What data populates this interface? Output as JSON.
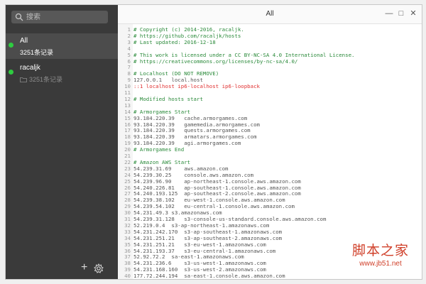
{
  "sidebar": {
    "search_placeholder": "搜索",
    "hosts": [
      {
        "title": "All",
        "subtitle": "3251条记录",
        "active": true
      },
      {
        "title": "racaljk",
        "subtitle": "3251条记录",
        "active": false
      }
    ],
    "add_label": "+",
    "settings_icon": "gear-icon"
  },
  "window": {
    "title": "All",
    "minimize": "—",
    "maximize": "□",
    "close": "✕"
  },
  "editor": {
    "lines": [
      {
        "n": "1",
        "t": "# Copyright (c) 2014-2016, racaljk.",
        "k": "comment"
      },
      {
        "n": "2",
        "t": "# https://github.com/racaljk/hosts",
        "k": "comment"
      },
      {
        "n": "3",
        "t": "# Last updated: 2016-12-18",
        "k": "comment"
      },
      {
        "n": "4",
        "t": "",
        "k": "plain"
      },
      {
        "n": "5",
        "t": "# This work is licensed under a CC BY-NC-SA 4.0 International License.",
        "k": "comment"
      },
      {
        "n": "6",
        "t": "# https://creativecommons.org/licenses/by-nc-sa/4.0/",
        "k": "comment"
      },
      {
        "n": "7",
        "t": "",
        "k": "plain"
      },
      {
        "n": "8",
        "t": "# Localhost (DO NOT REMOVE)",
        "k": "comment"
      },
      {
        "n": "9",
        "t": "127.0.0.1   local.host",
        "k": "plain"
      },
      {
        "n": "10",
        "t": "::1 localhost ip6-localhost ip6-loopback",
        "k": "red"
      },
      {
        "n": "11",
        "t": "",
        "k": "plain"
      },
      {
        "n": "12",
        "t": "# Modified hosts start",
        "k": "comment"
      },
      {
        "n": "13",
        "t": "",
        "k": "plain"
      },
      {
        "n": "14",
        "t": "# Armorgames Start",
        "k": "comment"
      },
      {
        "n": "15",
        "t": "93.184.220.39   cache.armorgames.com",
        "k": "plain"
      },
      {
        "n": "16",
        "t": "93.184.220.39   gamemedia.armorgames.com",
        "k": "plain"
      },
      {
        "n": "17",
        "t": "93.184.220.39   quests.armorgames.com",
        "k": "plain"
      },
      {
        "n": "18",
        "t": "93.184.220.39   armatars.armorgames.com",
        "k": "plain"
      },
      {
        "n": "19",
        "t": "93.184.220.39   agi.armorgames.com",
        "k": "plain"
      },
      {
        "n": "20",
        "t": "# Armorgames End",
        "k": "comment"
      },
      {
        "n": "21",
        "t": "",
        "k": "plain"
      },
      {
        "n": "22",
        "t": "# Amazon AWS Start",
        "k": "comment"
      },
      {
        "n": "23",
        "t": "54.239.31.69    aws.amazon.com",
        "k": "plain"
      },
      {
        "n": "24",
        "t": "54.239.30.25    console.aws.amazon.com",
        "k": "plain"
      },
      {
        "n": "25",
        "t": "54.239.96.90    ap-northeast-1.console.aws.amazon.com",
        "k": "plain"
      },
      {
        "n": "26",
        "t": "54.240.226.81   ap-southeast-1.console.aws.amazon.com",
        "k": "plain"
      },
      {
        "n": "27",
        "t": "54.240.193.125  ap-southeast-2.console.aws.amazon.com",
        "k": "plain"
      },
      {
        "n": "28",
        "t": "54.239.38.102   eu-west-1.console.aws.amazon.com",
        "k": "plain"
      },
      {
        "n": "29",
        "t": "54.239.54.102   eu-central-1.console.aws.amazon.com",
        "k": "plain"
      },
      {
        "n": "30",
        "t": "54.231.49.3 s3.amazonaws.com",
        "k": "plain"
      },
      {
        "n": "31",
        "t": "54.239.31.128   s3-console-us-standard.console.aws.amazon.com",
        "k": "plain"
      },
      {
        "n": "32",
        "t": "52.219.0.4  s3-ap-northeast-1.amazonaws.com",
        "k": "plain"
      },
      {
        "n": "33",
        "t": "54.231.242.170  s3-ap-southeast-1.amazonaws.com",
        "k": "plain"
      },
      {
        "n": "34",
        "t": "54.231.251.21   s3-ap-southeast-2.amazonaws.com",
        "k": "plain"
      },
      {
        "n": "35",
        "t": "54.231.251.21   s3-eu-west-1.amazonaws.com",
        "k": "plain"
      },
      {
        "n": "36",
        "t": "54.231.193.37   s3-eu-central-1.amazonaws.com",
        "k": "plain"
      },
      {
        "n": "37",
        "t": "52.92.72.2  sa-east-1.amazonaws.com",
        "k": "plain"
      },
      {
        "n": "38",
        "t": "54.231.236.6    s3-us-west-1.amazonaws.com",
        "k": "plain"
      },
      {
        "n": "39",
        "t": "54.231.168.160  s3-us-west-2.amazonaws.com",
        "k": "plain"
      },
      {
        "n": "40",
        "t": "177.72.244.194  sa-east-1.console.aws.amazon.com",
        "k": "plain"
      }
    ]
  },
  "watermark": {
    "brand": "脚本之家",
    "url": "www.jb51.net"
  },
  "colors": {
    "sidebar": "#3a3a3a",
    "comment": "#2a8a3a",
    "loopback": "#e03030",
    "status_dot": "#2ecc40",
    "watermark": "#d0402a"
  }
}
